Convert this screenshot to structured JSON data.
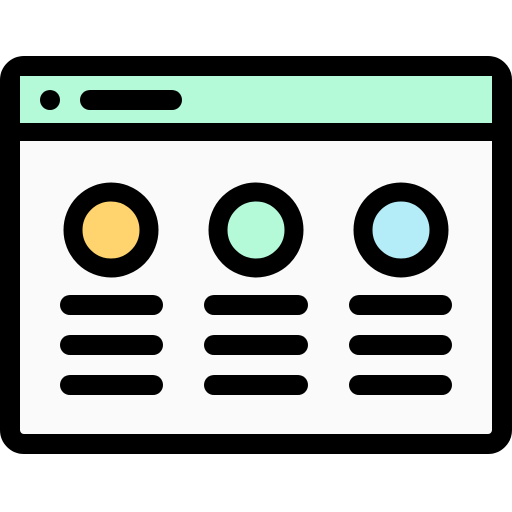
{
  "icon": {
    "name": "browser-window-with-three-columns",
    "colors": {
      "stroke": "#000000",
      "window_fill": "#FAFAFA",
      "titlebar_fill": "#B4FAD9",
      "circle_1_fill": "#FFD46E",
      "circle_2_fill": "#B4FAD9",
      "circle_3_fill": "#B4ECF7"
    },
    "columns": [
      {
        "id": "left",
        "lines": 3
      },
      {
        "id": "middle",
        "lines": 3
      },
      {
        "id": "right",
        "lines": 3
      }
    ]
  }
}
